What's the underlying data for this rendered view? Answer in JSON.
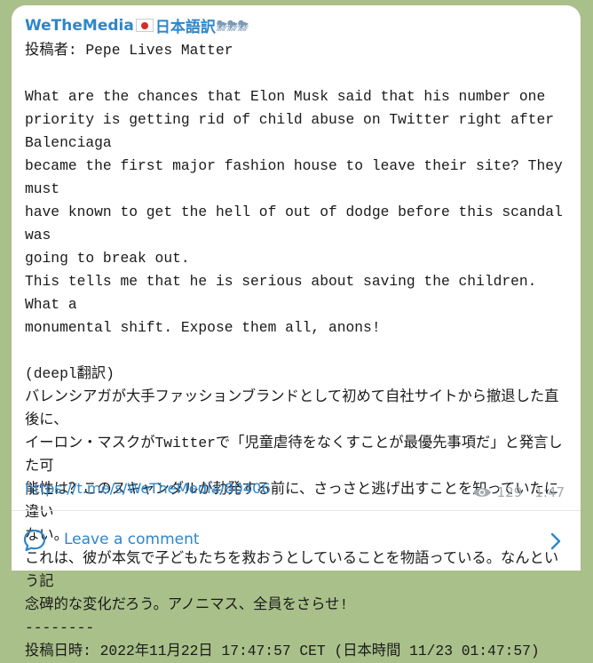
{
  "post": {
    "channel_name": "WeTheMedia",
    "channel_suffix": "日本語訳",
    "flag_icon": "japan-flag-icon",
    "storm_icons": "⛈⛈⛈",
    "body": "投稿者: Pepe Lives Matter\n\nWhat are the chances that Elon Musk said that his number one\npriority is getting rid of child abuse on Twitter right after Balenciaga\nbecame the first major fashion house to leave their site? They must\nhave known to get the hell of out of dodge before this scandal was\ngoing to break out.\nThis tells me that he is serious about saving the children. What a\nmonumental shift. Expose them all, anons!\n\n(deepl翻訳)\nバレンシアガが大手ファッションブランドとして初めて自社サイトから撤退した直後に、\nイーロン・マスクがTwitterで「児童虐待をなくすことが最優先事項だ」と発言した可\n能性は？このスキャンダルが勃発する前に、さっさと逃げ出すことを知っていたに違い\nない。\nこれは、彼が本気で子どもたちを救おうとしていることを物語っている。なんという記\n念碑的な変化だろう。アノニマス、全員をさらせ!\n--------\n投稿日時: 2022年11月22日 17:47:57 CET (日本時間 11/23 01:47:57)",
    "link": "https://t.me/s/WeTheMedia/80406",
    "views": "129",
    "time": "1:47"
  },
  "comments": {
    "label": "Leave a comment"
  },
  "colors": {
    "accent": "#2f86c9",
    "background": "#a9c08a"
  }
}
